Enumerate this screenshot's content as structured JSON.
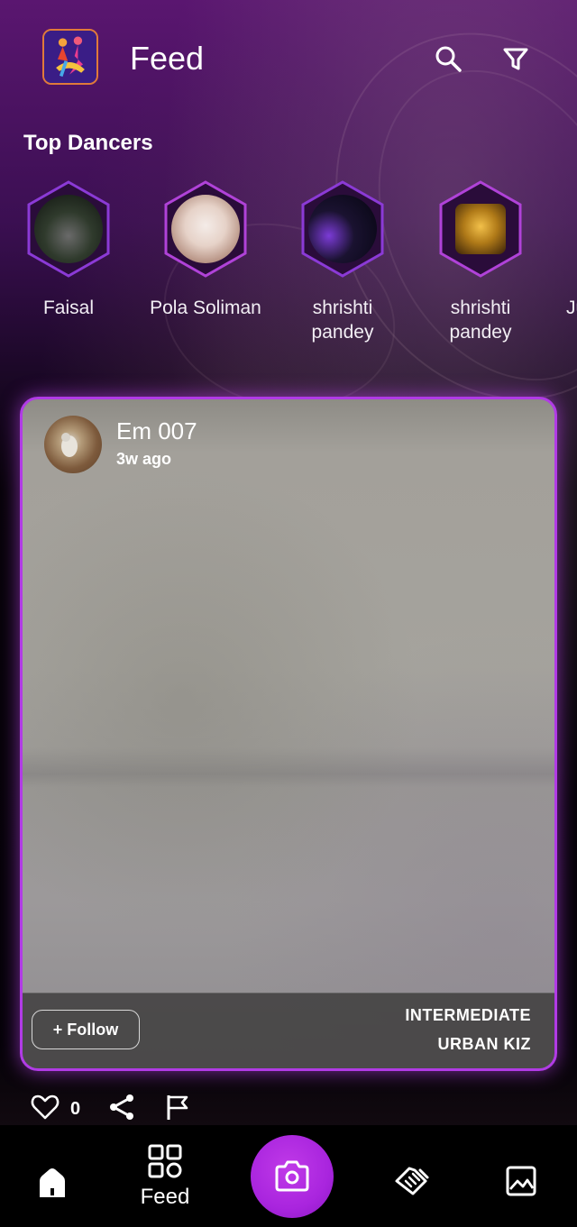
{
  "header": {
    "title": "Feed",
    "logo_icon": "dancing-couple-logo",
    "search_icon": "search-icon",
    "filter_icon": "filter-icon"
  },
  "top_dancers": {
    "title": "Top Dancers",
    "items": [
      {
        "name": "Faisal",
        "avatar": "person-with-umbrella-photo"
      },
      {
        "name": "Pola Soliman",
        "avatar": "hands-photo"
      },
      {
        "name": "shrishti pandey",
        "avatar": "city-night-photo"
      },
      {
        "name": "shrishti pandey",
        "avatar": "gold-dancers-photo"
      },
      {
        "name": "Ju",
        "avatar": "partial-avatar"
      }
    ]
  },
  "post": {
    "author": "Em 007",
    "time": "3w ago",
    "follow_label": "+ Follow",
    "level": "INTERMEDIATE",
    "style": "URBAN KIZ"
  },
  "actions": {
    "like_count": "0"
  },
  "bottom_nav": {
    "feed_label": "Feed"
  },
  "colors": {
    "accent": "#a925de",
    "card_border": "#b13be6",
    "header_purple": "#5a1670"
  }
}
